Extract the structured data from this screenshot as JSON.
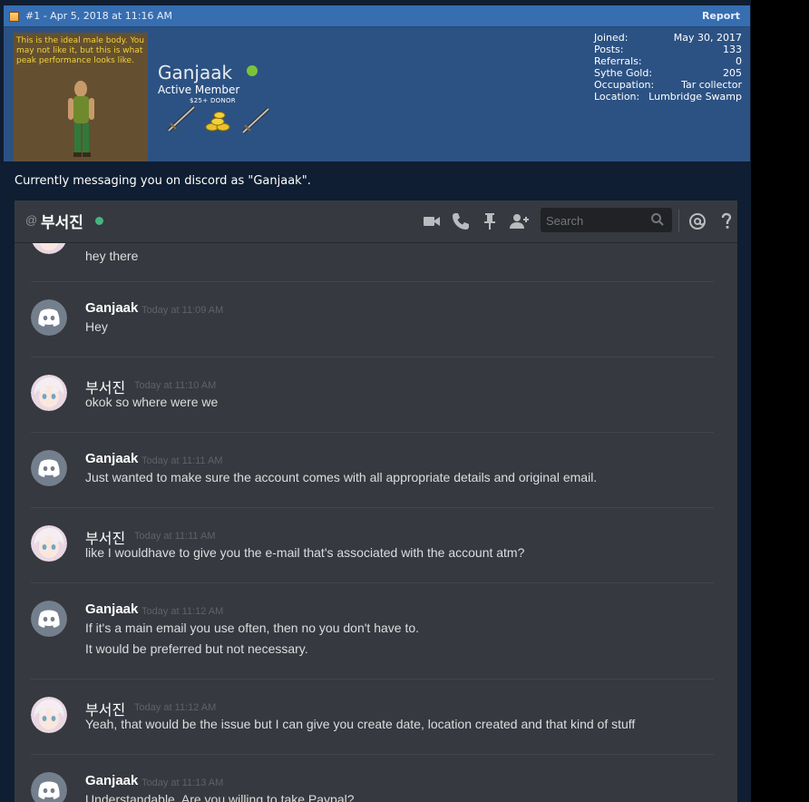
{
  "post": {
    "meta": "#1 - Apr 5, 2018 at 11:16 AM",
    "report_label": "Report",
    "signature": "Currently messaging you on discord as \"Ganjaak\"."
  },
  "user": {
    "name": "Ganjaak",
    "title": "Active Member",
    "donor_badge": "$25+ DONOR",
    "avatar_caption": [
      "This is the ideal male body. You",
      "may not like it, but this is what",
      "peak performance looks like."
    ],
    "stats": [
      {
        "label": "Joined:",
        "value": "May 30, 2017"
      },
      {
        "label": "Posts:",
        "value": "133"
      },
      {
        "label": "Referrals:",
        "value": "0"
      },
      {
        "label": "Sythe Gold:",
        "value": "205"
      },
      {
        "label": "Occupation:",
        "value": "Tar collector"
      },
      {
        "label": "Location:",
        "value": "Lumbridge Swamp"
      }
    ]
  },
  "discord": {
    "at_symbol": "@",
    "channel_name": "부서진",
    "search_placeholder": "Search",
    "header_icons": [
      "video-call-icon",
      "phone-call-icon",
      "pin-icon",
      "add-friend-icon",
      "mention-icon",
      "help-icon"
    ],
    "colors": {
      "background": "#36393f",
      "online": "#43b581",
      "discord_avatar": "#747f8d"
    },
    "first_fragment": "hey there",
    "messages": [
      {
        "author": "Ganjaak",
        "time": "Today at 11:09 AM",
        "lines": [
          "Hey"
        ]
      },
      {
        "author": "부서진",
        "time": "Today at 11:10 AM",
        "lines": [
          "okok so where were we"
        ]
      },
      {
        "author": "Ganjaak",
        "time": "Today at 11:11 AM",
        "lines": [
          "Just wanted to make sure the account comes with all appropriate details and original email."
        ]
      },
      {
        "author": "부서진",
        "time": "Today at 11:11 AM",
        "lines": [
          "like I wouldhave to give you the e-mail that's associated with the account atm?"
        ]
      },
      {
        "author": "Ganjaak",
        "time": "Today at 11:12 AM",
        "lines": [
          "If it's a main email you use often, then no you don't have to.",
          "It would be preferred but not necessary."
        ]
      },
      {
        "author": "부서진",
        "time": "Today at 11:12 AM",
        "lines": [
          "Yeah, that would be the issue but I can give you create date, location created and that kind of stuff"
        ]
      },
      {
        "author": "Ganjaak",
        "time": "Today at 11:13 AM",
        "lines": [
          "Understandable. Are you willing to take Paypal?"
        ]
      }
    ]
  }
}
